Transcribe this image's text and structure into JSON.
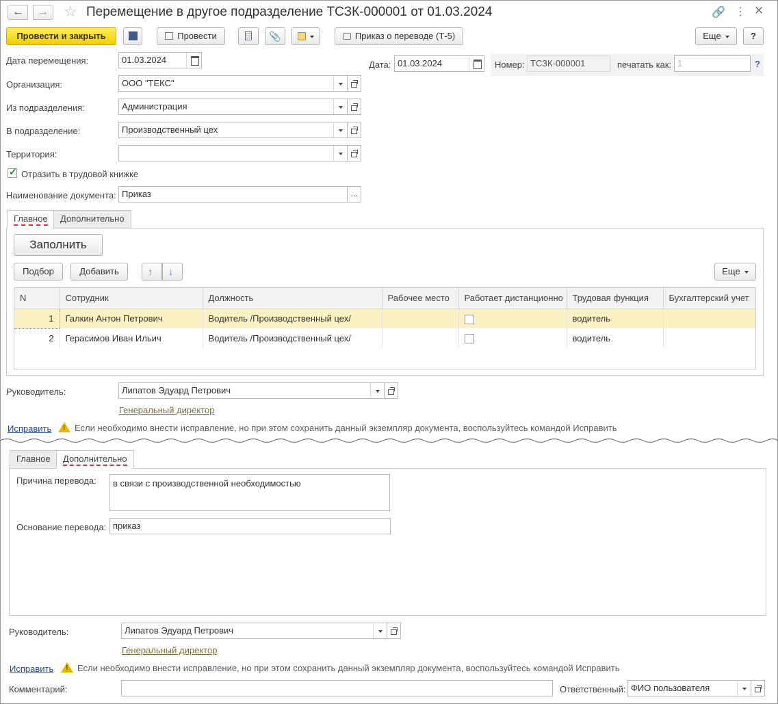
{
  "title": "Перемещение в другое подразделение ТСЗК-000001 от 01.03.2024",
  "toolbar": {
    "post_close": "Провести и закрыть",
    "post": "Провести",
    "print_order": "Приказ о переводе (Т-5)",
    "more": "Еще",
    "help": "?"
  },
  "form": {
    "move_date_label": "Дата перемещения:",
    "move_date": "01.03.2024",
    "date_label": "Дата:",
    "date": "01.03.2024",
    "number_label": "Номер:",
    "number": "ТСЗК-000001",
    "print_as_label": "печатать как:",
    "print_as_placeholder": "1",
    "org_label": "Организация:",
    "org": "ООО \"ТЕКС\"",
    "from_dept_label": "Из подразделения:",
    "from_dept": "Администрация",
    "to_dept_label": "В подразделение:",
    "to_dept": "Производственный цех",
    "territory_label": "Территория:",
    "territory": "",
    "workbook_label": "Отразить в трудовой книжке",
    "docname_label": "Наименование документа:",
    "docname": "Приказ",
    "docname_btn": "..."
  },
  "tabs": {
    "main": "Главное",
    "extra": "Дополнительно"
  },
  "main_tab": {
    "fill": "Заполнить",
    "pick": "Подбор",
    "add": "Добавить",
    "more": "Еще",
    "columns": [
      "N",
      "Сотрудник",
      "Должность",
      "Рабочее место",
      "Работает дистанционно",
      "Трудовая функция",
      "Бухгалтерский учет"
    ],
    "rows": [
      {
        "n": "1",
        "employee": "Галкин Антон Петрович",
        "position": "Водитель /Производственный цех/",
        "workplace": "",
        "function": "водитель",
        "accounting": ""
      },
      {
        "n": "2",
        "employee": "Герасимов Иван Ильич",
        "position": "Водитель /Производственный цех/",
        "workplace": "",
        "function": "водитель",
        "accounting": ""
      }
    ]
  },
  "footer": {
    "head_label": "Руководитель:",
    "head": "Липатов Эдуард Петрович",
    "head_position": "Генеральный директор",
    "fix_link": "Исправить",
    "fix_note": "Если необходимо внести исправление, но при этом сохранить данный экземпляр документа, воспользуйтесь командой Исправить"
  },
  "extra_tab": {
    "reason_label": "Причина перевода:",
    "reason": "в связи с производственной необходимостью",
    "basis_label": "Основание перевода:",
    "basis": "приказ"
  },
  "bottom": {
    "comment_label": "Комментарий:",
    "comment": "",
    "responsible_label": "Ответственный:",
    "responsible": "ФИО пользователя"
  },
  "colors": {
    "accent_yellow": "#f2cf00",
    "selected_row": "#fbf1c3",
    "link_blue": "#1f4a92",
    "warning": "#e8b800"
  }
}
